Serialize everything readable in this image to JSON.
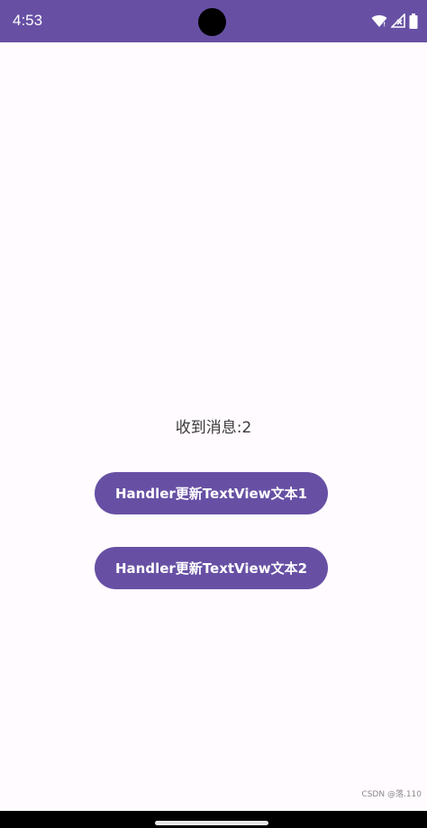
{
  "status_bar": {
    "time": "4:53",
    "color": "#6750a4",
    "icons": [
      "wifi-icon",
      "signal-icon",
      "battery-icon"
    ]
  },
  "main": {
    "message": "收到消息:2",
    "buttons": [
      {
        "label": "Handler更新TextView文本1"
      },
      {
        "label": "Handler更新TextView文本2"
      }
    ]
  },
  "watermark": "CSDN @落.110",
  "colors": {
    "primary": "#6750a4",
    "background": "#fffbfe",
    "text": "#3a3a3a"
  }
}
